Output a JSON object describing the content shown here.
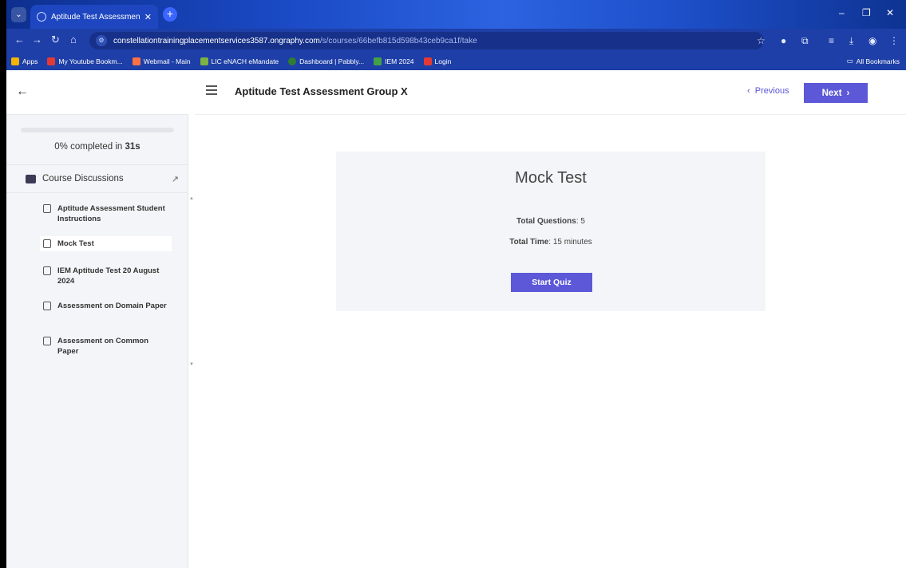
{
  "browser": {
    "tab_title": "Aptitude Test Assessment Grou",
    "url_host": "constellationtrainingplacementservices3587.ongraphy.com",
    "url_path": "/s/courses/66befb815d598b43ceb9ca1f/take",
    "bookmarks": [
      {
        "label": "Apps",
        "color": "#f4b400"
      },
      {
        "label": "My Youtube Bookm...",
        "color": "#e53935"
      },
      {
        "label": "Webmail - Main",
        "color": "#ff7043"
      },
      {
        "label": "LIC eNACH eMandate",
        "color": "#7cb342"
      },
      {
        "label": "Dashboard | Pabbly...",
        "color": "#2e7d32"
      },
      {
        "label": "IEM 2024",
        "color": "#43a047"
      },
      {
        "label": "Login",
        "color": "#e53935"
      }
    ],
    "all_bookmarks": "All Bookmarks"
  },
  "sidebar": {
    "progress_percent": 0,
    "progress_text_prefix": "0% completed in",
    "progress_time": "31s",
    "discussions_label": "Course Discussions",
    "items": [
      {
        "label": "Aptitude Assessment Student Instructions"
      },
      {
        "label": "Mock Test"
      },
      {
        "label": "IEM Aptitude Test 20 August 2024"
      },
      {
        "label": "Assessment on Domain Paper"
      },
      {
        "label": "Assessment on Common Paper"
      }
    ]
  },
  "header": {
    "course_title": "Aptitude Test Assessment Group X",
    "previous_label": "Previous",
    "next_label": "Next"
  },
  "quiz": {
    "title": "Mock Test",
    "total_questions_label": "Total Questions",
    "total_questions_value": ": 5",
    "total_time_label": "Total Time",
    "total_time_value": ": 15 minutes",
    "start_label": "Start Quiz"
  },
  "colors": {
    "accent": "#5c58d8",
    "browser_blue": "#1e3fa8"
  }
}
